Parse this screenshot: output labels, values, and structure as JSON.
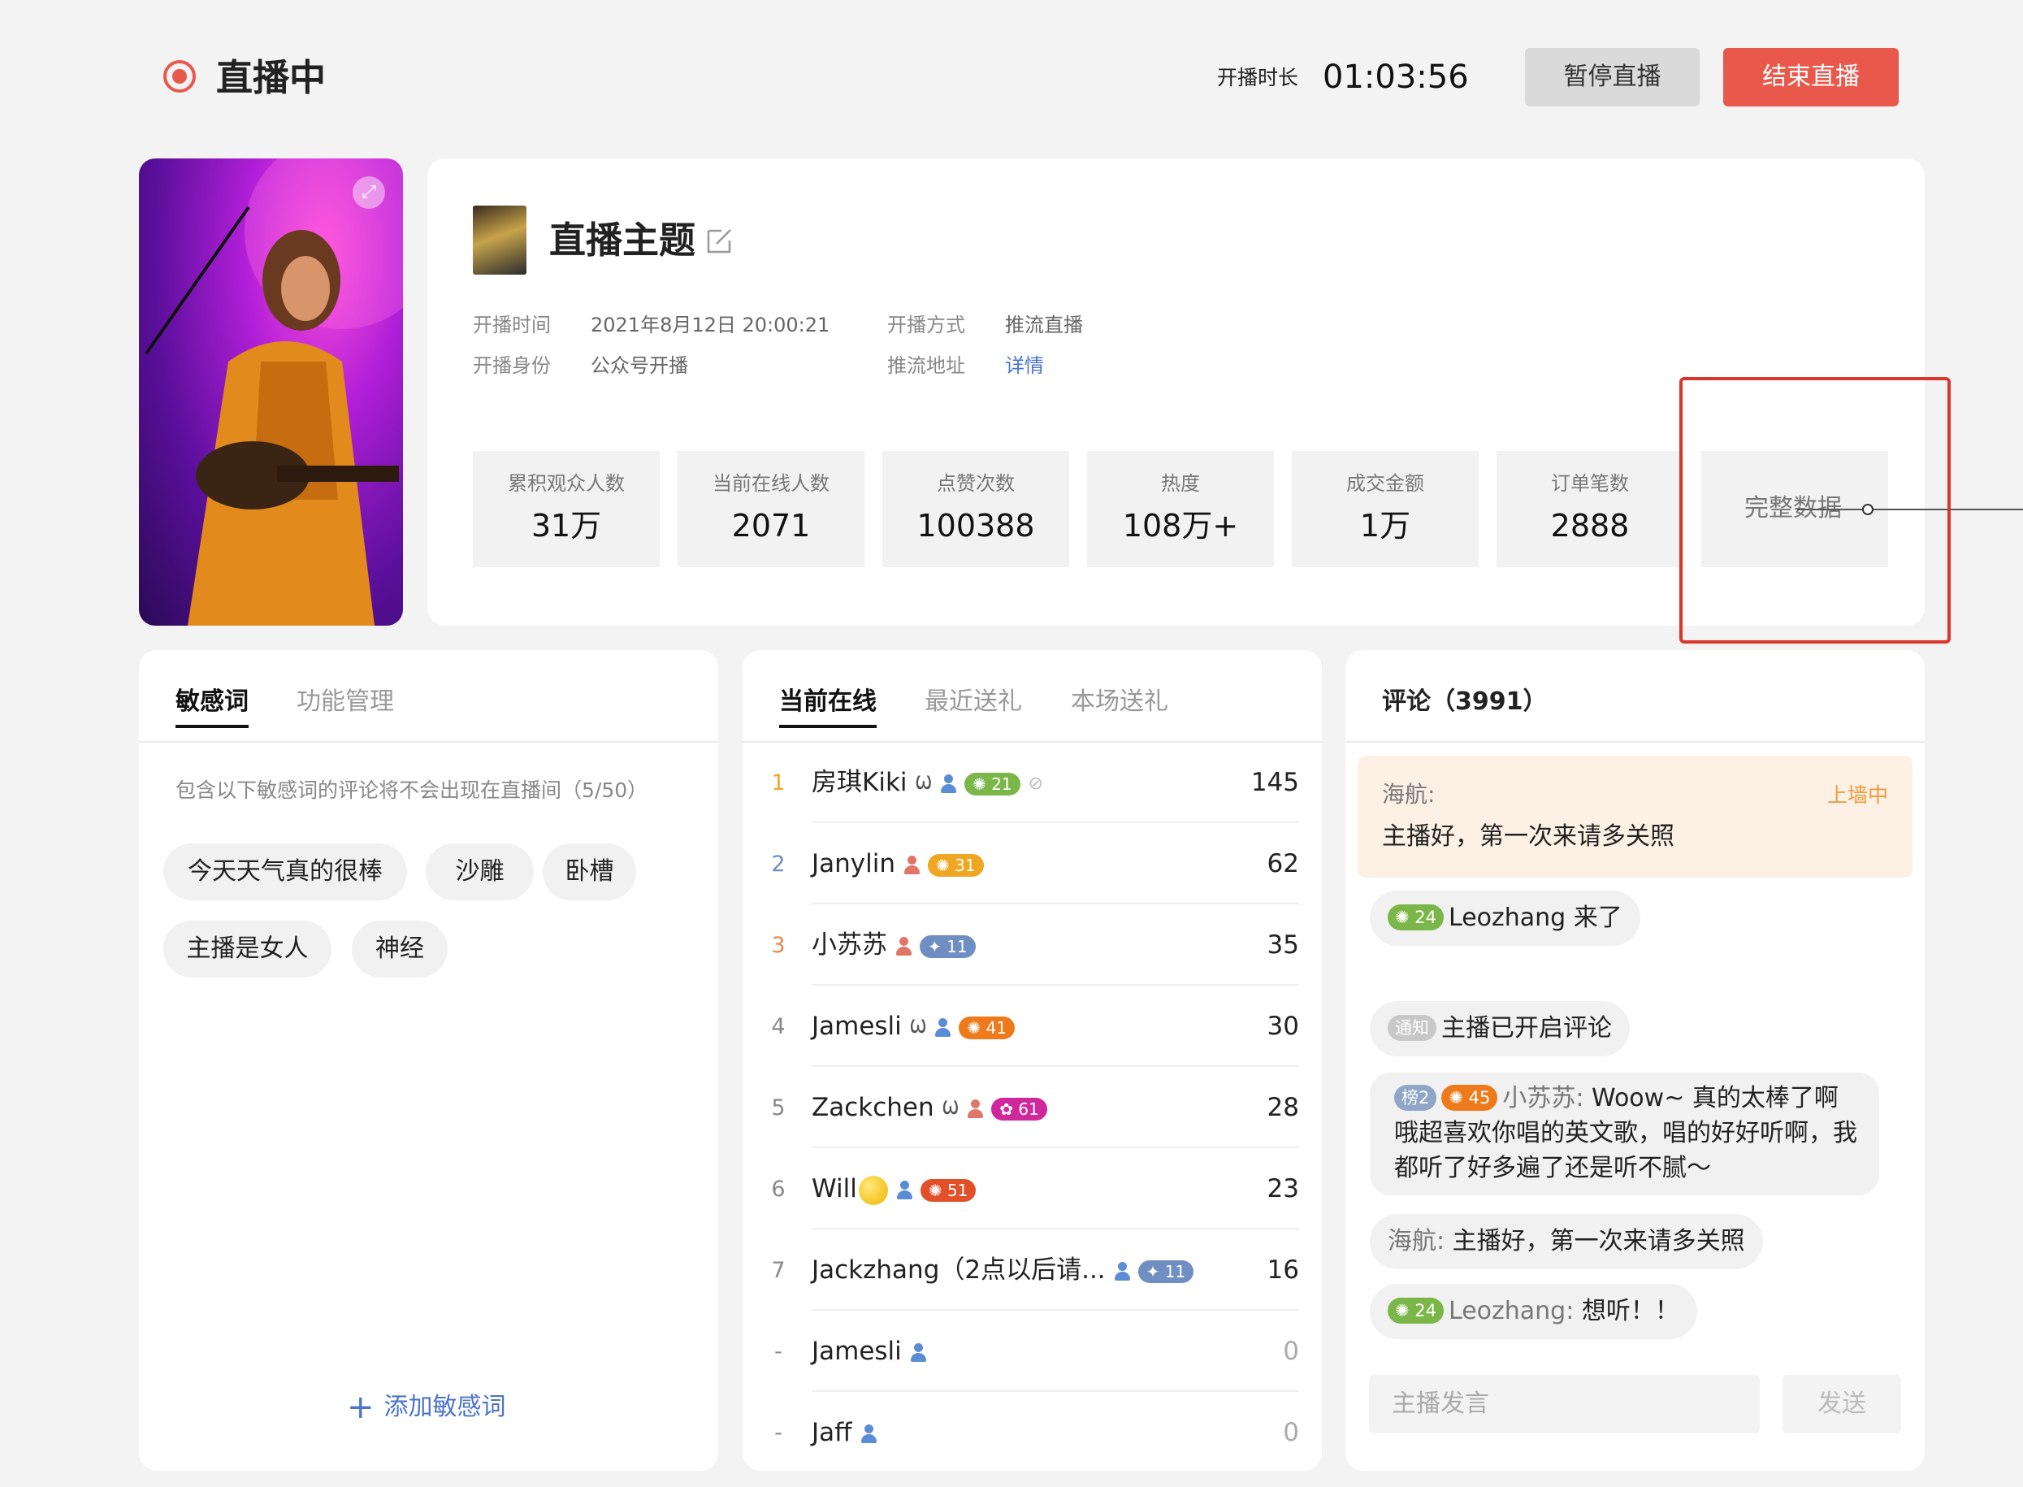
{
  "header": {
    "status": "直播中",
    "duration_label": "开播时长",
    "duration": "01:03:56",
    "pause_label": "暂停直播",
    "end_label": "结束直播"
  },
  "info": {
    "topic": "直播主题",
    "meta": [
      {
        "label": "开播时间",
        "value": "2021年8月12日 20:00:21"
      },
      {
        "label": "开播身份",
        "value": "公众号开播"
      },
      {
        "label": "开播方式",
        "value": "推流直播"
      },
      {
        "label": "推流地址",
        "value": "详情"
      }
    ],
    "stats": [
      {
        "label": "累积观众人数",
        "value": "31万"
      },
      {
        "label": "当前在线人数",
        "value": "2071"
      },
      {
        "label": "点赞次数",
        "value": "100388"
      },
      {
        "label": "热度",
        "value": "108万+"
      },
      {
        "label": "成交金额",
        "value": "1万"
      },
      {
        "label": "订单笔数",
        "value": "2888"
      }
    ],
    "full_data_label": "完整数据"
  },
  "sensitive": {
    "tabs": [
      "敏感词",
      "功能管理"
    ],
    "hint": "包含以下敏感词的评论将不会出现在直播间（5/50）",
    "words": [
      "今天天气真的很棒",
      "沙雕",
      "卧槽",
      "主播是女人",
      "神经"
    ],
    "add_label": "添加敏感词"
  },
  "online": {
    "tabs": [
      "当前在线",
      "最近送礼",
      "本场送礼"
    ],
    "rows": [
      {
        "rank": "1",
        "name": "房琪Kiki",
        "gender": "male",
        "level": "21",
        "level_color": "#7ab648",
        "count": "145"
      },
      {
        "rank": "2",
        "name": "Janylin",
        "gender": "female",
        "level": "31",
        "level_color": "#f0a622",
        "count": "62"
      },
      {
        "rank": "3",
        "name": "小苏苏",
        "gender": "female",
        "level": "11",
        "level_color": "#6f8fc2",
        "count": "35"
      },
      {
        "rank": "4",
        "name": "Jamesli",
        "gender": "male",
        "level": "41",
        "level_color": "#ee7a1b",
        "count": "30"
      },
      {
        "rank": "5",
        "name": "Zackchen",
        "gender": "female",
        "level": "61",
        "level_color": "#d0279c",
        "count": "28"
      },
      {
        "rank": "6",
        "name": "Will",
        "gender": "male",
        "level": "51",
        "level_color": "#e2502a",
        "count": "23"
      },
      {
        "rank": "7",
        "name": "Jackzhang（2点以后请...",
        "gender": "male",
        "level": "11",
        "level_color": "#6f8fc2",
        "count": "16"
      },
      {
        "rank": "-",
        "name": "Jamesli",
        "gender": "male",
        "level": "",
        "level_color": "",
        "count": "0"
      },
      {
        "rank": "-",
        "name": "Jaff",
        "gender": "male",
        "level": "",
        "level_color": "",
        "count": "0"
      }
    ]
  },
  "comments": {
    "title": "评论（3991）",
    "pinned": {
      "who": "海航:",
      "msg": "主播好，第一次来请多关照",
      "tag": "上墙中"
    },
    "entry1": {
      "badge": "24",
      "text": "Leozhang 来了"
    },
    "notice": {
      "badge": "通知",
      "text": "主播已开启评论"
    },
    "c1": {
      "rank_badge": "榜2",
      "badge": "45",
      "name": "小苏苏:",
      "text": "Woow~ 真的太棒了啊哦超喜欢你唱的英文歌，唱的好好听啊，我都听了好多遍了还是听不腻～"
    },
    "c2": {
      "name": "海航:",
      "text": "主播好，第一次来请多关照"
    },
    "c3": {
      "badge": "24",
      "name": "Leozhang:",
      "text": "想听！！"
    },
    "input_placeholder": "主播发言",
    "send_label": "发送"
  }
}
